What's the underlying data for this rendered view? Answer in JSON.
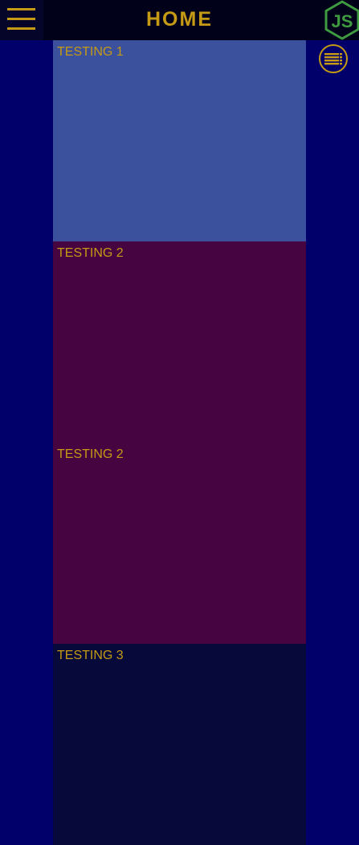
{
  "header": {
    "title": "HOME",
    "menu_icon": "hamburger-menu-icon",
    "logo_icon": "nodejs-hexagon-logo",
    "logo_text": "JS",
    "list_icon": "list-view-icon"
  },
  "cards": [
    {
      "label": "TESTING 1",
      "color": "#3b519e"
    },
    {
      "label": "TESTING 2",
      "color": "#460441"
    },
    {
      "label": "TESTING 2",
      "color": "#460441"
    },
    {
      "label": "TESTING 3",
      "color": "#07093a"
    }
  ],
  "colors": {
    "background": "#01006b",
    "header_background": "#02011a",
    "accent": "#c59a14",
    "logo_green": "#3f9b3f"
  }
}
